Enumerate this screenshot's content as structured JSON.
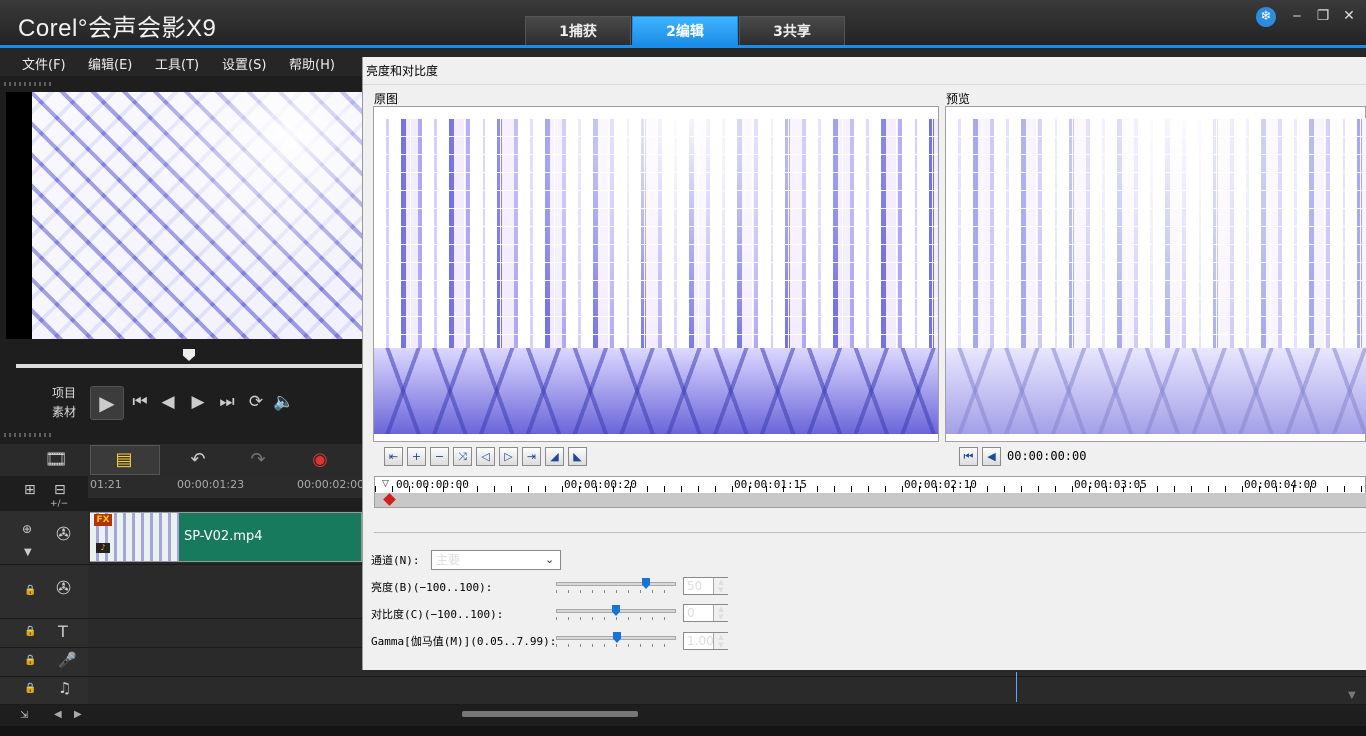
{
  "app": {
    "title": "Corel°会声会影X9"
  },
  "main_tabs": [
    {
      "label": "1捕获"
    },
    {
      "label": "2编辑"
    },
    {
      "label": "3共享"
    }
  ],
  "menu": [
    "文件(F)",
    "编辑(E)",
    "工具(T)",
    "设置(S)",
    "帮助(H)"
  ],
  "player": {
    "mode_project": "项目",
    "mode_clip": "素材"
  },
  "timeline": {
    "ticks": [
      "01:21",
      "00:00:01:23",
      "00:00:02:00"
    ],
    "clip_name": "SP-V02.mp4",
    "clip_badge": "FX",
    "track_sub": "+/−"
  },
  "dialog": {
    "title": "亮度和对比度",
    "original_label": "原图",
    "preview_label": "预览",
    "timecode": "00:00:00:00",
    "ruler_labels": [
      "00:00:00:00",
      "00:00:00:20",
      "00:00:01:15",
      "00:00:02:10",
      "00:00:03:05",
      "00:00:04:00"
    ],
    "channel_label": "通道(N):",
    "channel_value": "主要",
    "brightness_label": "亮度(B)(−100..100):",
    "brightness_value": "50",
    "brightness_level": 50,
    "contrast_label": "对比度(C)(−100..100):",
    "contrast_value": "0",
    "contrast_level": 0,
    "gamma_label": "Gamma[伽马值(M)](0.05..7.99):",
    "gamma_value": "1.00"
  },
  "colors": {
    "accent": "#1d8be8",
    "clip": "#177a5d",
    "keyframe": "#d0201a"
  }
}
